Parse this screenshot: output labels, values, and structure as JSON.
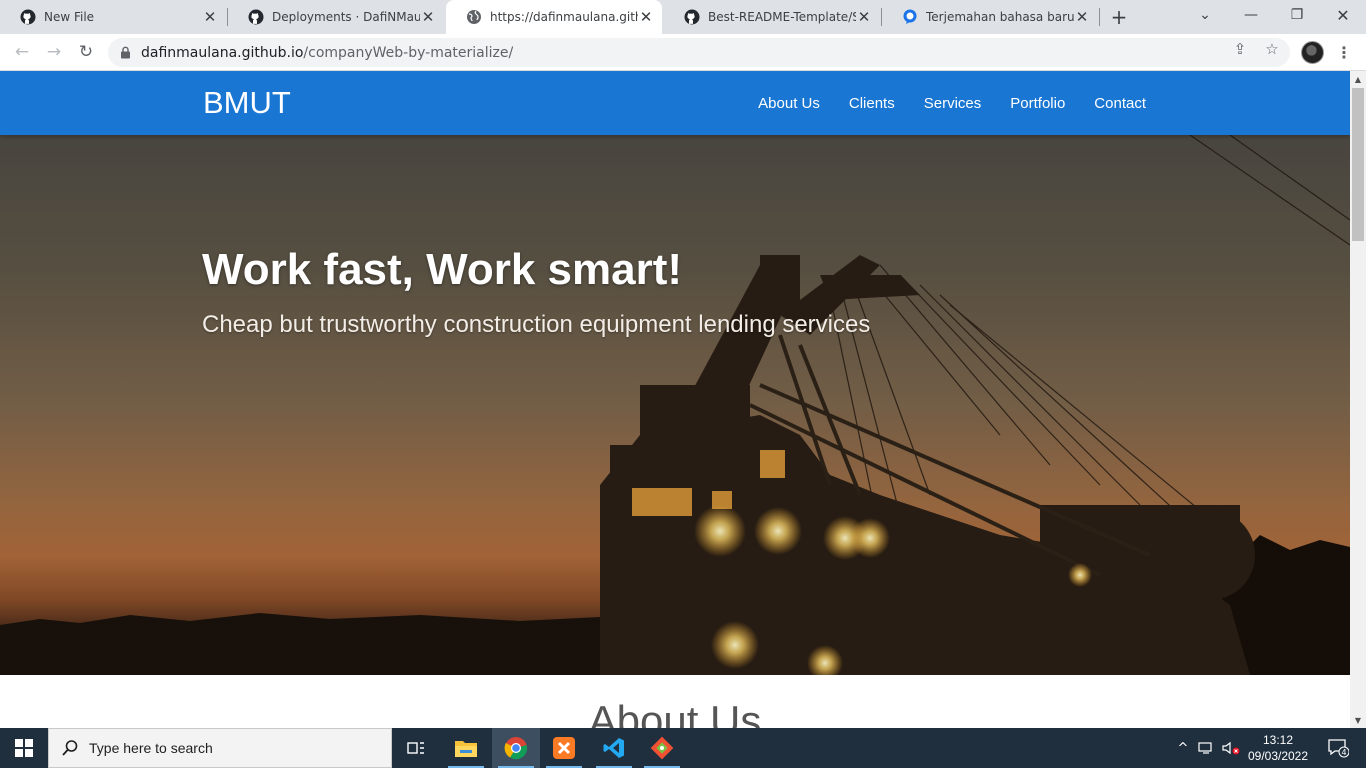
{
  "browser": {
    "tabs": [
      {
        "title": "New File",
        "icon": "github-icon",
        "active": false
      },
      {
        "title": "Deployments · DafiNMaulana",
        "icon": "github-icon",
        "active": false
      },
      {
        "title": "https://dafinmaulana.github.io",
        "icon": "globe-icon",
        "active": true
      },
      {
        "title": "Best-README-Template/Scre",
        "icon": "github-icon",
        "active": false
      },
      {
        "title": "Terjemahan bahasa baru - ba",
        "icon": "chat-icon",
        "active": false
      }
    ],
    "url_host": "dafinmaulana.github.io",
    "url_path": "/companyWeb-by-materialize/"
  },
  "site": {
    "brand": "BMUT",
    "nav": [
      "About Us",
      "Clients",
      "Services",
      "Portfolio",
      "Contact"
    ],
    "nav_color": "#1976d2",
    "hero_title": "Work fast, Work smart!",
    "hero_subtitle": "Cheap but trustworthy construction equipment lending services",
    "section_heading": "About Us"
  },
  "taskbar": {
    "search_placeholder": "Type here to search",
    "apps": [
      "task-view-icon",
      "file-explorer-icon",
      "chrome-icon",
      "xampp-icon",
      "vscode-icon",
      "git-gui-icon"
    ],
    "time": "13:12",
    "date": "09/03/2022",
    "notifications": "4"
  }
}
